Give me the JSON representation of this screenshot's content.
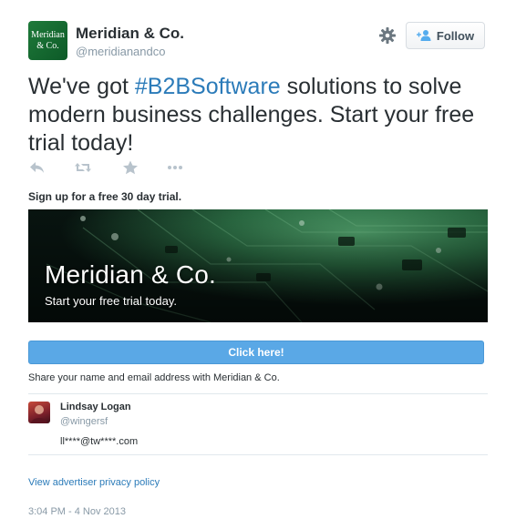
{
  "header": {
    "avatar_line1": "Meridian",
    "avatar_line2": "& Co.",
    "display_name": "Meridian & Co.",
    "handle": "@meridianandco",
    "follow_label": "Follow"
  },
  "tweet": {
    "text_before": "We've got ",
    "hashtag": "#B2BSoftware",
    "text_after": " solutions to solve modern business challenges. Start your free trial today!"
  },
  "actions": {
    "icons": [
      "reply-icon",
      "retweet-icon",
      "favorite-icon",
      "more-icon"
    ]
  },
  "card": {
    "headline": "Sign up for a free 30 day trial.",
    "banner_title": "Meridian & Co.",
    "banner_subtitle": "Start your free trial today.",
    "cta_label": "Click here!",
    "share_text": "Share your name and email address with Meridian & Co."
  },
  "user": {
    "name": "Lindsay Logan",
    "handle": "@wingersf",
    "email": "ll****@tw****.com"
  },
  "footer": {
    "privacy_link": "View advertiser privacy policy",
    "timestamp": "3:04 PM - 4 Nov 2013"
  },
  "colors": {
    "link": "#2b7bb9",
    "cta": "#5aa8e6",
    "muted": "#8899a6",
    "text": "#292f33"
  }
}
